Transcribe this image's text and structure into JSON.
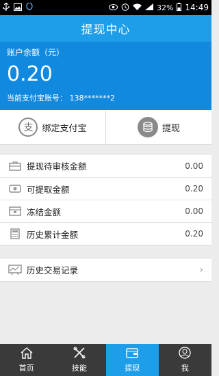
{
  "status_bar": {
    "battery": "32%",
    "time": "14:49",
    "left_icons": [
      "usb-icon",
      "image-icon",
      "qq-icon"
    ],
    "right_icons": [
      "eye-icon",
      "alarm-icon",
      "wifi-icon",
      "signal-icon",
      "battery-icon"
    ]
  },
  "header": {
    "title": "提现中心"
  },
  "account": {
    "label": "账户余额（元）",
    "balance": "0.20",
    "alipay_line": "当前支付宝账号： 138*******2"
  },
  "actions": {
    "bind_alipay": {
      "label": "绑定支付宝",
      "icon": "alipay-icon",
      "icon_char": "支"
    },
    "withdraw": {
      "label": "提现",
      "icon": "coins-icon"
    }
  },
  "list": [
    {
      "label": "提现待审核金额",
      "value": "0.00",
      "icon": "briefcase-icon"
    },
    {
      "label": "可提取金额",
      "value": "0.20",
      "icon": "cash-icon"
    },
    {
      "label": "冻结金额",
      "value": "0.00",
      "icon": "box-icon"
    },
    {
      "label": "历史累计金额",
      "value": "0.20",
      "icon": "calculator-icon"
    }
  ],
  "history": {
    "label": "历史交易记录",
    "icon": "chart-icon"
  },
  "nav": [
    {
      "label": "首页",
      "icon": "home-icon"
    },
    {
      "label": "技能",
      "icon": "tools-icon"
    },
    {
      "label": "提现",
      "icon": "wallet-icon",
      "active": true
    },
    {
      "label": "我",
      "icon": "user-icon"
    }
  ],
  "colors": {
    "title_bar": "#1e9de9",
    "account_panel": "#1189df",
    "nav_bg": "#3a3a3a",
    "nav_active": "#1e9de9"
  }
}
